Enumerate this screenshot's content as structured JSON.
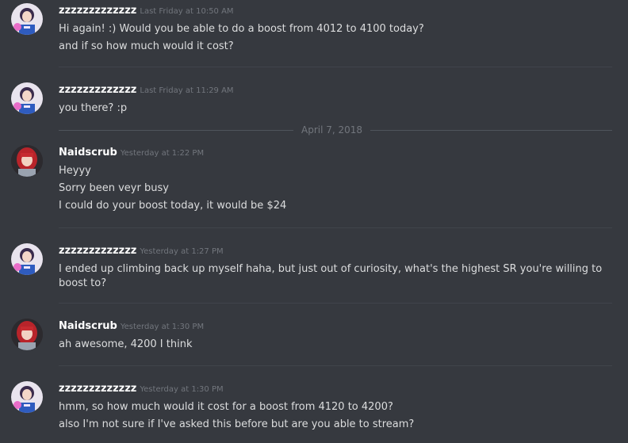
{
  "divider": {
    "date": "April 7, 2018"
  },
  "messages": [
    {
      "username": "zzzzzzzzzzzzz",
      "timestamp": "Last Friday at 10:50 AM",
      "lines": [
        "Hi again! :) Would you be able to do a boost from 4012 to 4100 today?",
        "and if so how much would it cost?"
      ]
    },
    {
      "username": "zzzzzzzzzzzzz",
      "timestamp": "Last Friday at 11:29 AM",
      "lines": [
        "you there? :p"
      ]
    },
    {
      "username": "Naidscrub",
      "timestamp": "Yesterday at 1:22 PM",
      "lines": [
        "Heyyy",
        "Sorry been veyr busy",
        "I could do your boost today, it would be $24"
      ]
    },
    {
      "username": "zzzzzzzzzzzzz",
      "timestamp": "Yesterday at 1:27 PM",
      "lines": [
        "I ended up climbing back up myself haha, but just out of curiosity, what's the highest SR you're willing to boost to?"
      ]
    },
    {
      "username": "Naidscrub",
      "timestamp": "Yesterday at 1:30 PM",
      "lines": [
        "ah awesome, 4200 I think"
      ]
    },
    {
      "username": "zzzzzzzzzzzzz",
      "timestamp": "Yesterday at 1:30 PM",
      "lines": [
        "hmm, so how much would it cost for a boost from 4120 to 4200?",
        "also I'm not sure if I've asked this before but are you able to stream?"
      ]
    }
  ]
}
